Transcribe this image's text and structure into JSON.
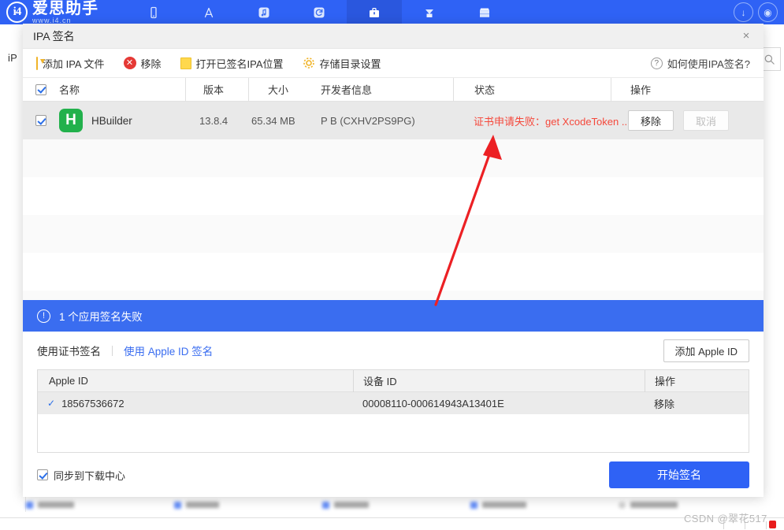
{
  "app": {
    "brand_name": "爱思助手",
    "brand_url": "www.i4.cn",
    "brand_mark": "i4",
    "nav": [
      {
        "name": "device-icon",
        "glyph": "▯"
      },
      {
        "name": "appstore-icon",
        "glyph": "A"
      },
      {
        "name": "music-icon",
        "glyph": "♪"
      },
      {
        "name": "refresh-icon",
        "glyph": "⟳"
      },
      {
        "name": "toolbox-icon",
        "glyph": "▣",
        "active": true
      },
      {
        "name": "download-icon",
        "glyph": "▼"
      },
      {
        "name": "shop-icon",
        "glyph": "▤"
      }
    ],
    "left_label": "iP",
    "search_icon": "search-icon",
    "watermark": "CSDN @翠花517",
    "accent_blue": "#2f62f5"
  },
  "dialog": {
    "title": "IPA 签名",
    "close_label": "×",
    "toolbar": {
      "add_ipa": "添加 IPA 文件",
      "remove": "移除",
      "open_signed_location": "打开已签名IPA位置",
      "storage_settings": "存储目录设置",
      "help": "如何使用IPA签名?"
    },
    "table": {
      "columns": [
        "名称",
        "版本",
        "大小",
        "开发者信息",
        "状态",
        "操作"
      ],
      "header_checked": true,
      "rows": [
        {
          "checked": true,
          "icon_letter": "H",
          "icon_color": "#22b14c",
          "name": "HBuilder",
          "version": "13.8.4",
          "size": "65.34 MB",
          "developer": "P B (CXHV2PS9PG)",
          "status": "证书申请失败：get XcodeToken ...",
          "status_color": "#f5483b",
          "action_primary": "移除",
          "action_secondary": "取消",
          "action_secondary_disabled": true
        }
      ]
    },
    "banner": {
      "icon": "warning-circle-icon",
      "text": "1 个应用签名失败",
      "background": "#3a6df0"
    },
    "sign_tabs": {
      "cert_tab": "使用证书签名",
      "appleid_tab": "使用 Apple ID 签名",
      "add_apple_id": "添加 Apple ID"
    },
    "apple_table": {
      "columns": [
        "Apple ID",
        "设备 ID",
        "操作"
      ],
      "rows": [
        {
          "selected": true,
          "apple_id": "18567536672",
          "device_id": "00008110-000614943A13401E",
          "action": "移除"
        }
      ]
    },
    "footer": {
      "sync_label": "同步到下载中心",
      "sync_checked": true,
      "start_button": "开始签名"
    }
  },
  "annotation": {
    "arrow_color": "#ec2024",
    "name": "red-arrow-pointing-to-status"
  }
}
